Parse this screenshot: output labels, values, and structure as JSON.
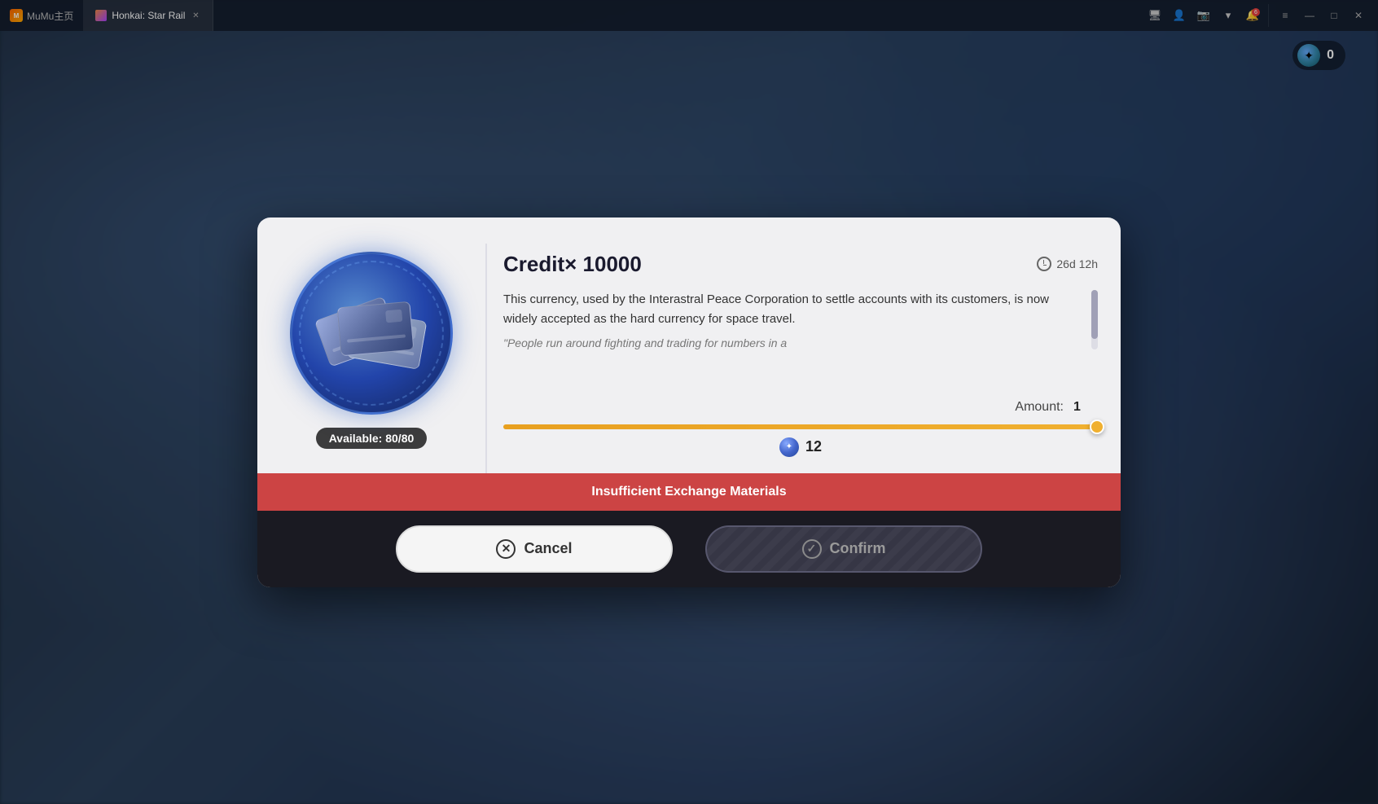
{
  "topBar": {
    "mumuTab": {
      "label": "MuMu主页"
    },
    "activeTab": {
      "label": "Honkai: Star Rail"
    },
    "icons": {
      "monitor": "🖥",
      "person": "👤",
      "camera": "📷",
      "chevronDown": "▾",
      "bell": "🔔",
      "notificationCount": "6",
      "menu": "≡",
      "minimize": "—",
      "maximize": "□",
      "close": "✕"
    }
  },
  "currency": {
    "value": "0"
  },
  "modal": {
    "itemTitle": "Credit× 10000",
    "timeRemaining": "26d 12h",
    "description": "This currency, used by the Interastral Peace Corporation to settle accounts with its customers, is now widely accepted as the hard currency for space travel.",
    "flavorText": "\"People run around fighting and trading for numbers in a",
    "amountLabel": "Amount:",
    "amountValue": "1",
    "sliderPercent": 100,
    "costValue": "12",
    "availableText": "Available: 80/80",
    "warningText": "Insufficient Exchange Materials",
    "cancelLabel": "Cancel",
    "confirmLabel": "Confirm"
  }
}
